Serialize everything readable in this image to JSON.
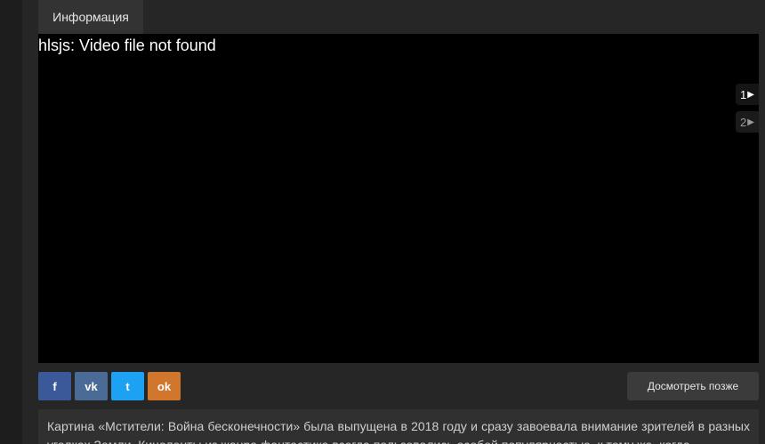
{
  "tabs": [
    {
      "label": "Информация"
    }
  ],
  "player": {
    "error_text": "hlsjs: Video file not found",
    "episodes": [
      {
        "label": "1",
        "arrow": "▶"
      },
      {
        "label": "2",
        "arrow": "▶"
      }
    ]
  },
  "social": [
    {
      "icon": "facebook-icon",
      "glyph": "f",
      "color": "#3b5998"
    },
    {
      "icon": "vk-icon",
      "glyph": "vk",
      "color": "#4a6b95"
    },
    {
      "icon": "twitter-icon",
      "glyph": "t",
      "color": "#1da1f2"
    },
    {
      "icon": "odnoklassniki-icon",
      "glyph": "ok",
      "color": "#d1772d"
    }
  ],
  "actions": {
    "watch_later_label": "Досмотреть позже"
  },
  "description": {
    "text": "Картина «Мстители: Война бесконечности» была выпущена в 2018 году и сразу завоевала внимание зрителей в разных уголках Земли. Киноленты из жанра фантастика всегда пользовались особой популярностью, к тому же, когда"
  }
}
